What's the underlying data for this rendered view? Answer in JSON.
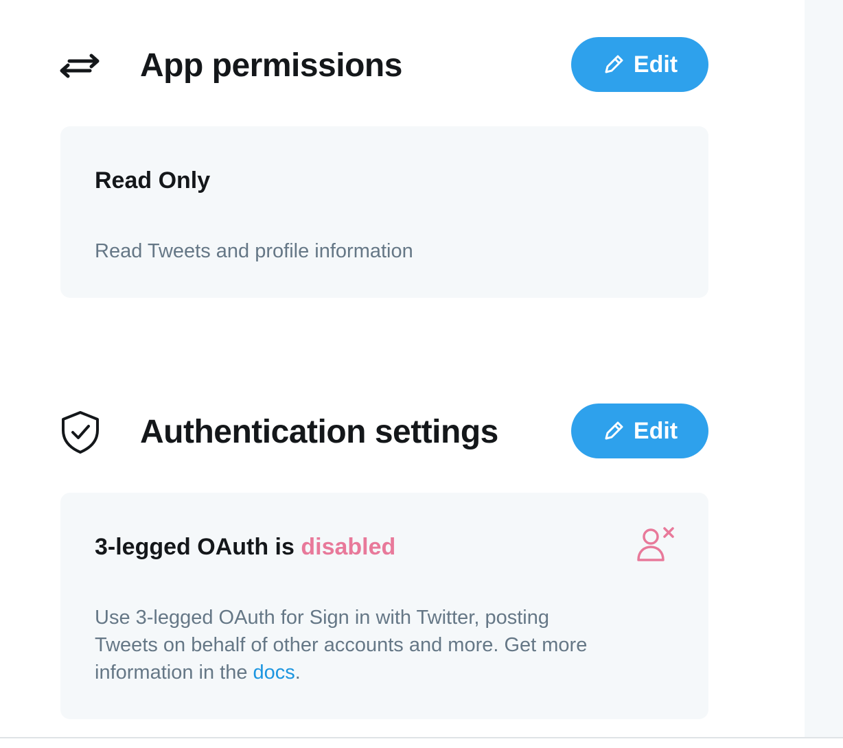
{
  "permissions_section": {
    "icon": "swap-arrows-icon",
    "title": "App permissions",
    "edit_label": "Edit",
    "card": {
      "title": "Read Only",
      "description": "Read Tweets and profile information"
    }
  },
  "auth_section": {
    "icon": "shield-check-icon",
    "title": "Authentication settings",
    "edit_label": "Edit",
    "card": {
      "title_prefix": "3-legged OAuth is ",
      "title_status": "disabled",
      "status_icon": "user-x-icon",
      "description_prefix": "Use 3-legged OAuth for Sign in with Twitter, posting Tweets on behalf of other accounts and more. Get more information in the ",
      "docs_link": "docs",
      "description_suffix": "."
    }
  },
  "colors": {
    "accent": "#2ea1ec",
    "card_background": "#f5f8fa",
    "disabled_status": "#e8799a",
    "link": "#1b95e0",
    "muted_text": "#657786"
  }
}
